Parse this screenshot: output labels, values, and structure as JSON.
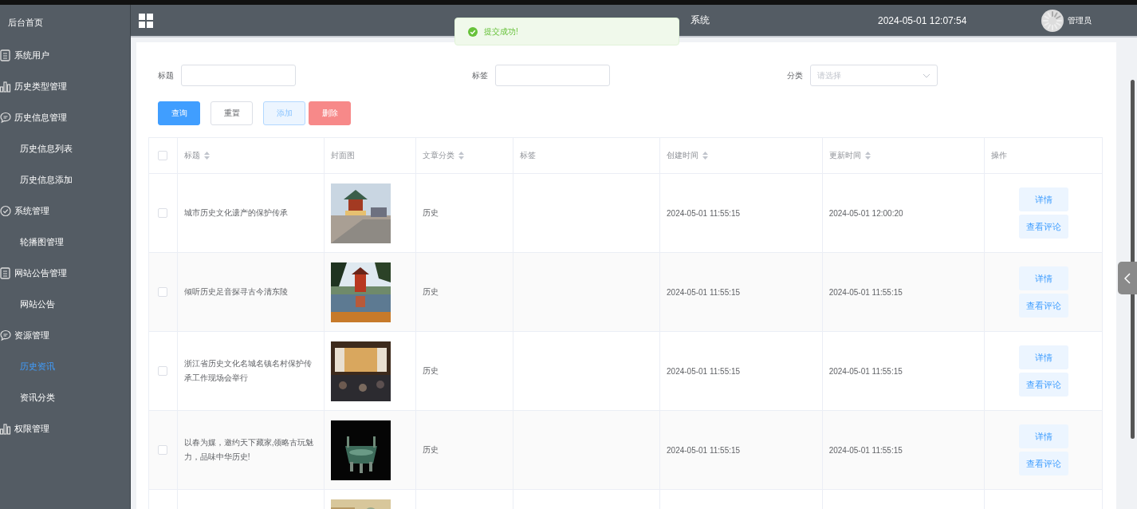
{
  "sidebar": {
    "home": "后台首页",
    "items": [
      {
        "label": "系统用户",
        "kind": "doc"
      },
      {
        "label": "历史类型管理",
        "kind": "chart"
      },
      {
        "label": "历史信息管理",
        "kind": "chat",
        "children": [
          {
            "label": "历史信息列表",
            "selected": false
          },
          {
            "label": "历史信息添加",
            "selected": false
          }
        ]
      },
      {
        "label": "系统管理",
        "kind": "check",
        "children": [
          {
            "label": "轮播图管理",
            "selected": false
          }
        ]
      },
      {
        "label": "网站公告管理",
        "kind": "doc",
        "children": [
          {
            "label": "网站公告",
            "selected": false
          }
        ]
      },
      {
        "label": "资源管理",
        "kind": "chat",
        "children": [
          {
            "label": "历史资讯",
            "selected": true
          },
          {
            "label": "资讯分类",
            "selected": false
          }
        ]
      },
      {
        "label": "权限管理",
        "kind": "chart"
      }
    ]
  },
  "header": {
    "title": "系统",
    "datetime": "2024-05-01 12:07:54",
    "user": "管理员"
  },
  "toast": {
    "message": "提交成功!"
  },
  "filters": [
    {
      "label": "标题",
      "kind": "input"
    },
    {
      "label": "标签",
      "kind": "input"
    },
    {
      "label": "分类",
      "kind": "select",
      "placeholder": "请选择"
    }
  ],
  "buttons": [
    {
      "label": "查询",
      "kind": "primary"
    },
    {
      "label": "重置",
      "kind": "default"
    },
    {
      "label": "添加",
      "kind": "plain"
    },
    {
      "label": "删除",
      "kind": "danger"
    }
  ],
  "table": {
    "all_checked": false,
    "columns": [
      {
        "label": "标题",
        "sortable": true
      },
      {
        "label": "封面图",
        "sortable": false
      },
      {
        "label": "文章分类",
        "sortable": true
      },
      {
        "label": "标签",
        "sortable": false
      },
      {
        "label": "创建时间",
        "sortable": true
      },
      {
        "label": "更新时间",
        "sortable": true
      },
      {
        "label": "操作",
        "sortable": false
      }
    ],
    "rows": [
      {
        "checked": false,
        "title": "城市历史文化遗产的保护传承",
        "cover": {
          "kind": "picture"
        },
        "category": "历史",
        "created": "2024-05-01 11:55:15",
        "updated": "2024-05-01 12:00:20",
        "actions": [
          "详情",
          "查看评论"
        ]
      },
      {
        "checked": false,
        "title": "倾听历史足音探寻古今清东陵",
        "cover": {
          "kind": "picture"
        },
        "category": "历史",
        "created": "2024-05-01 11:55:15",
        "updated": "2024-05-01 11:55:15",
        "actions": [
          "详情",
          "查看评论"
        ]
      },
      {
        "checked": false,
        "title": "浙江省历史文化名城名镇名村保护传承工作现场会举行",
        "cover": {
          "kind": "picture"
        },
        "category": "历史",
        "created": "2024-05-01 11:55:15",
        "updated": "2024-05-01 11:55:15",
        "actions": [
          "详情",
          "查看评论"
        ]
      },
      {
        "checked": false,
        "title": "以春为媒，邀约天下藏家,领略古玩魅力，品味中华历史!",
        "cover": {
          "kind": "picture"
        },
        "category": "历史",
        "created": "2024-05-01 11:55:15",
        "updated": "2024-05-01 11:55:15",
        "actions": [
          "详情",
          "查看评论"
        ]
      },
      {
        "cover": {
          "kind": "picture"
        }
      }
    ]
  }
}
